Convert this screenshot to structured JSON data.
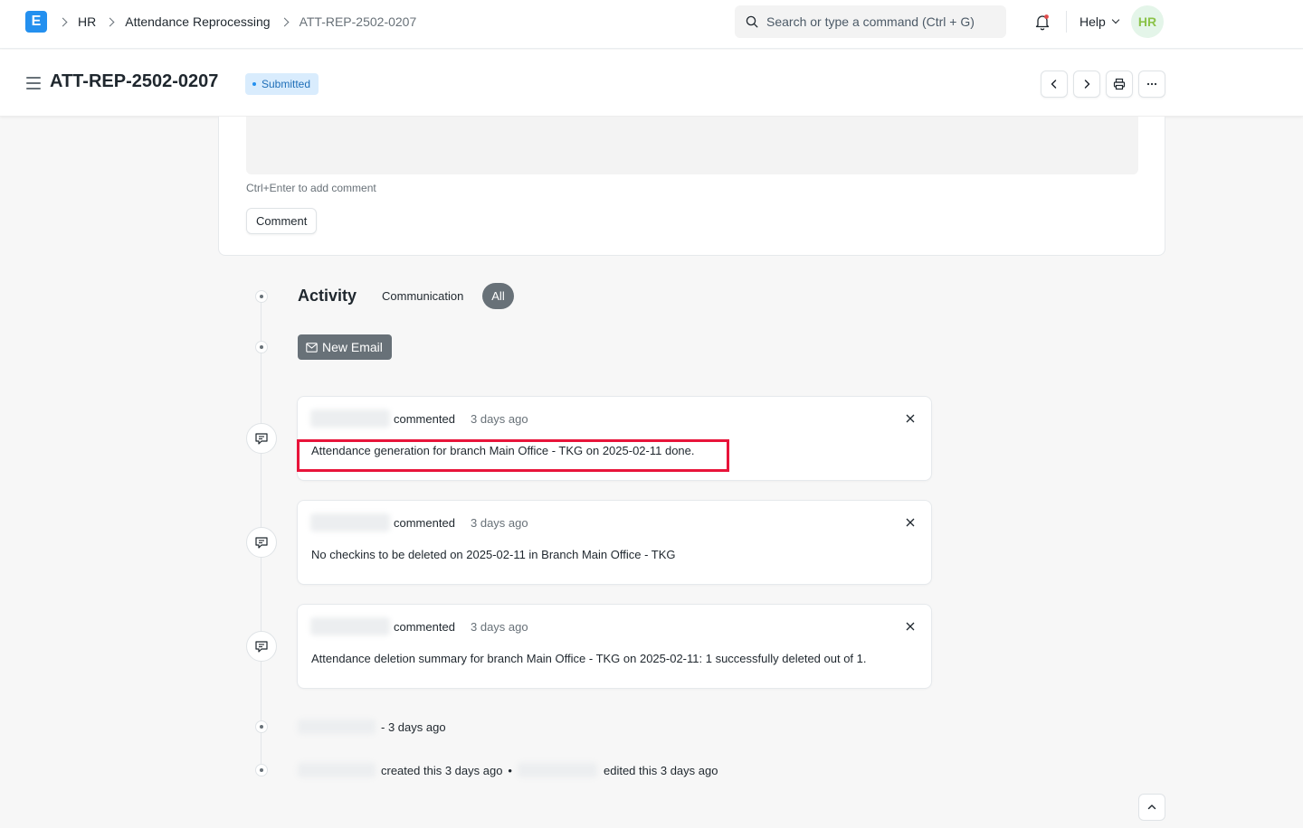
{
  "navbar": {
    "logo_letter": "E",
    "breadcrumbs": [
      "HR",
      "Attendance Reprocessing",
      "ATT-REP-2502-0207"
    ],
    "search_placeholder": "Search or type a command (Ctrl + G)",
    "help_label": "Help",
    "avatar_initials": "HR"
  },
  "page": {
    "title": "ATT-REP-2502-0207",
    "status": "Submitted"
  },
  "comment": {
    "hint": "Ctrl+Enter to add comment",
    "button_label": "Comment"
  },
  "activity": {
    "title": "Activity",
    "tabs": [
      "Communication",
      "All"
    ],
    "new_email_label": "New Email",
    "items": [
      {
        "verb": "commented",
        "time": "3 days ago",
        "text": "Attendance generation for branch Main Office - TKG on 2025-02-11 done."
      },
      {
        "verb": "commented",
        "time": "3 days ago",
        "text": "No checkins to be deleted on 2025-02-11 in Branch Main Office - TKG"
      },
      {
        "verb": "commented",
        "time": "3 days ago",
        "text": "Attendance deletion summary for branch Main Office - TKG on 2025-02-11: 1 successfully deleted out of 1."
      }
    ],
    "meta1": "- 3 days ago",
    "meta2_created": "created this 3 days ago",
    "meta2_sep": "•",
    "meta2_edited": "edited this 3 days ago"
  },
  "colors": {
    "primary": "#2490ef",
    "badge_bg": "#d9ecfd",
    "pill_gray": "#687178",
    "highlight": "#e8143a"
  }
}
